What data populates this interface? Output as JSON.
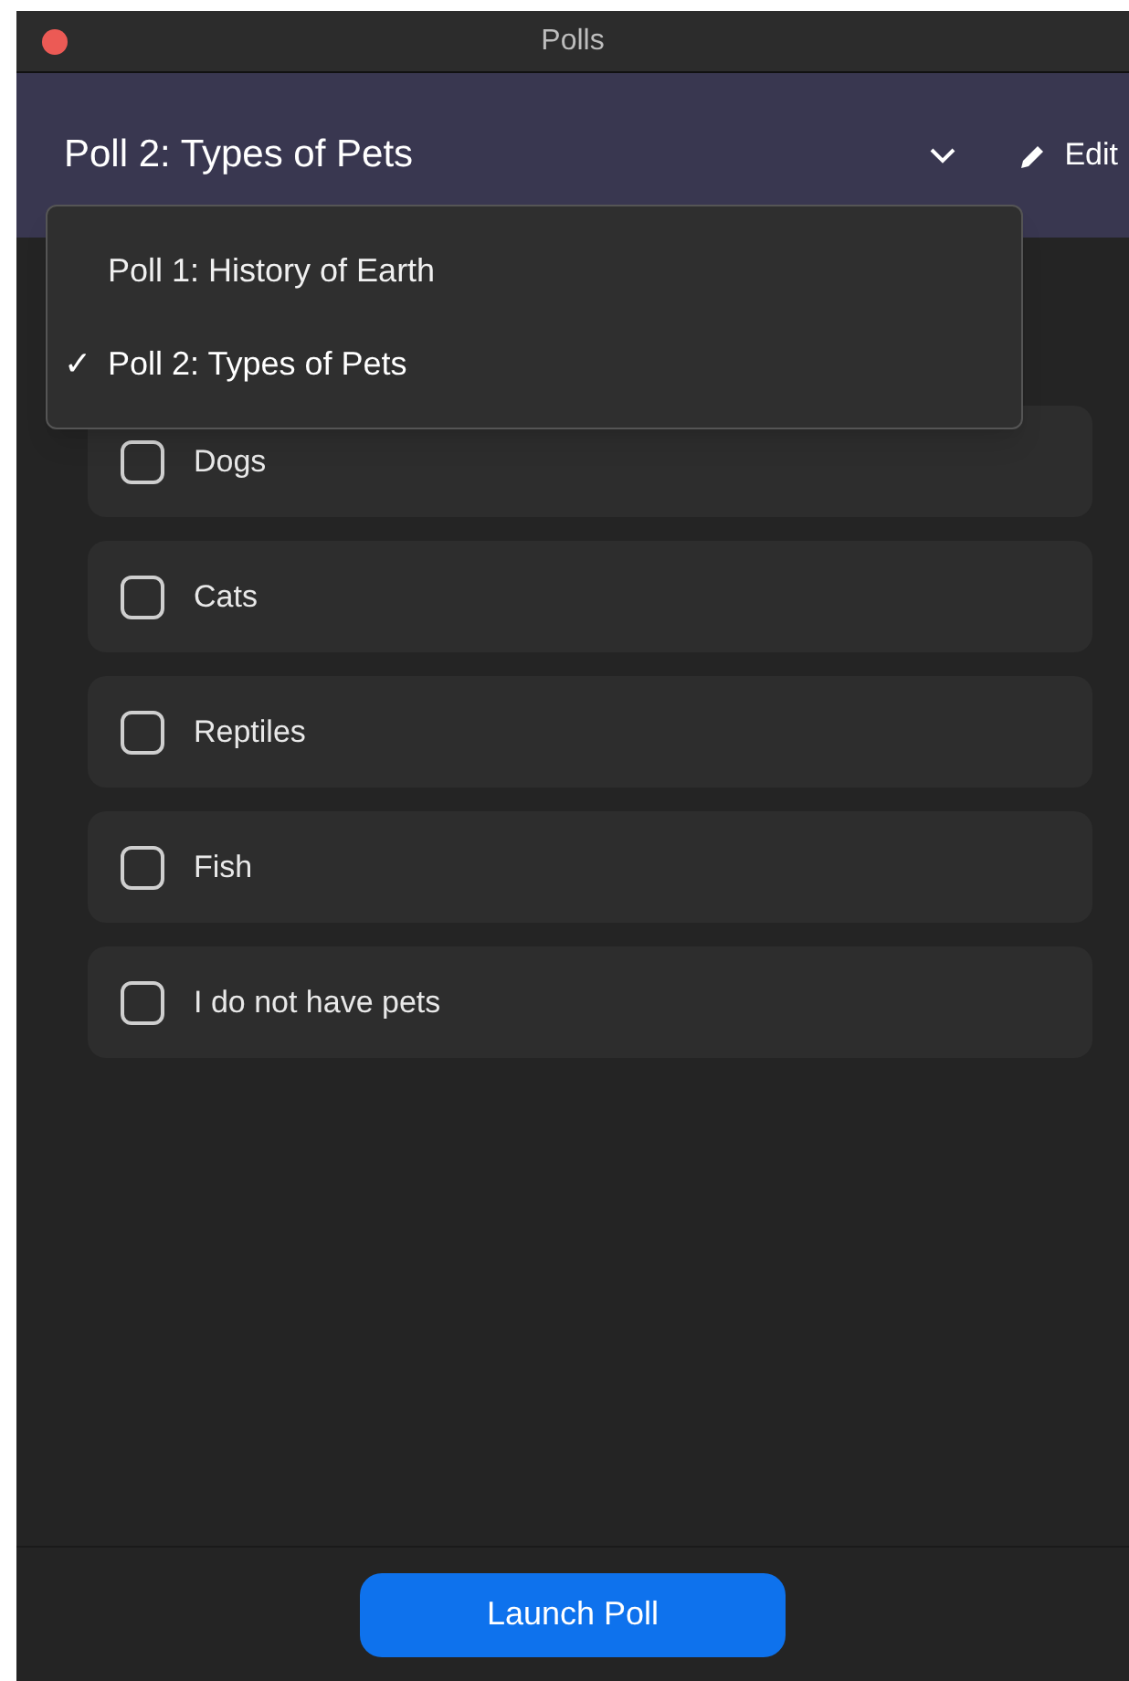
{
  "window": {
    "title": "Polls"
  },
  "header": {
    "poll_title": "Poll 2: Types of Pets",
    "edit_label": "Edit"
  },
  "dropdown": {
    "check_mark": "✓",
    "items": [
      {
        "label": "Poll 1: History of Earth",
        "selected": false
      },
      {
        "label": "Poll 2: Types of Pets",
        "selected": true
      }
    ]
  },
  "options": [
    {
      "label": "Dogs",
      "checked": false
    },
    {
      "label": "Cats",
      "checked": false
    },
    {
      "label": "Reptiles",
      "checked": false
    },
    {
      "label": "Fish",
      "checked": false
    },
    {
      "label": "I do not have pets",
      "checked": false
    }
  ],
  "footer": {
    "button": "Launch Poll"
  }
}
